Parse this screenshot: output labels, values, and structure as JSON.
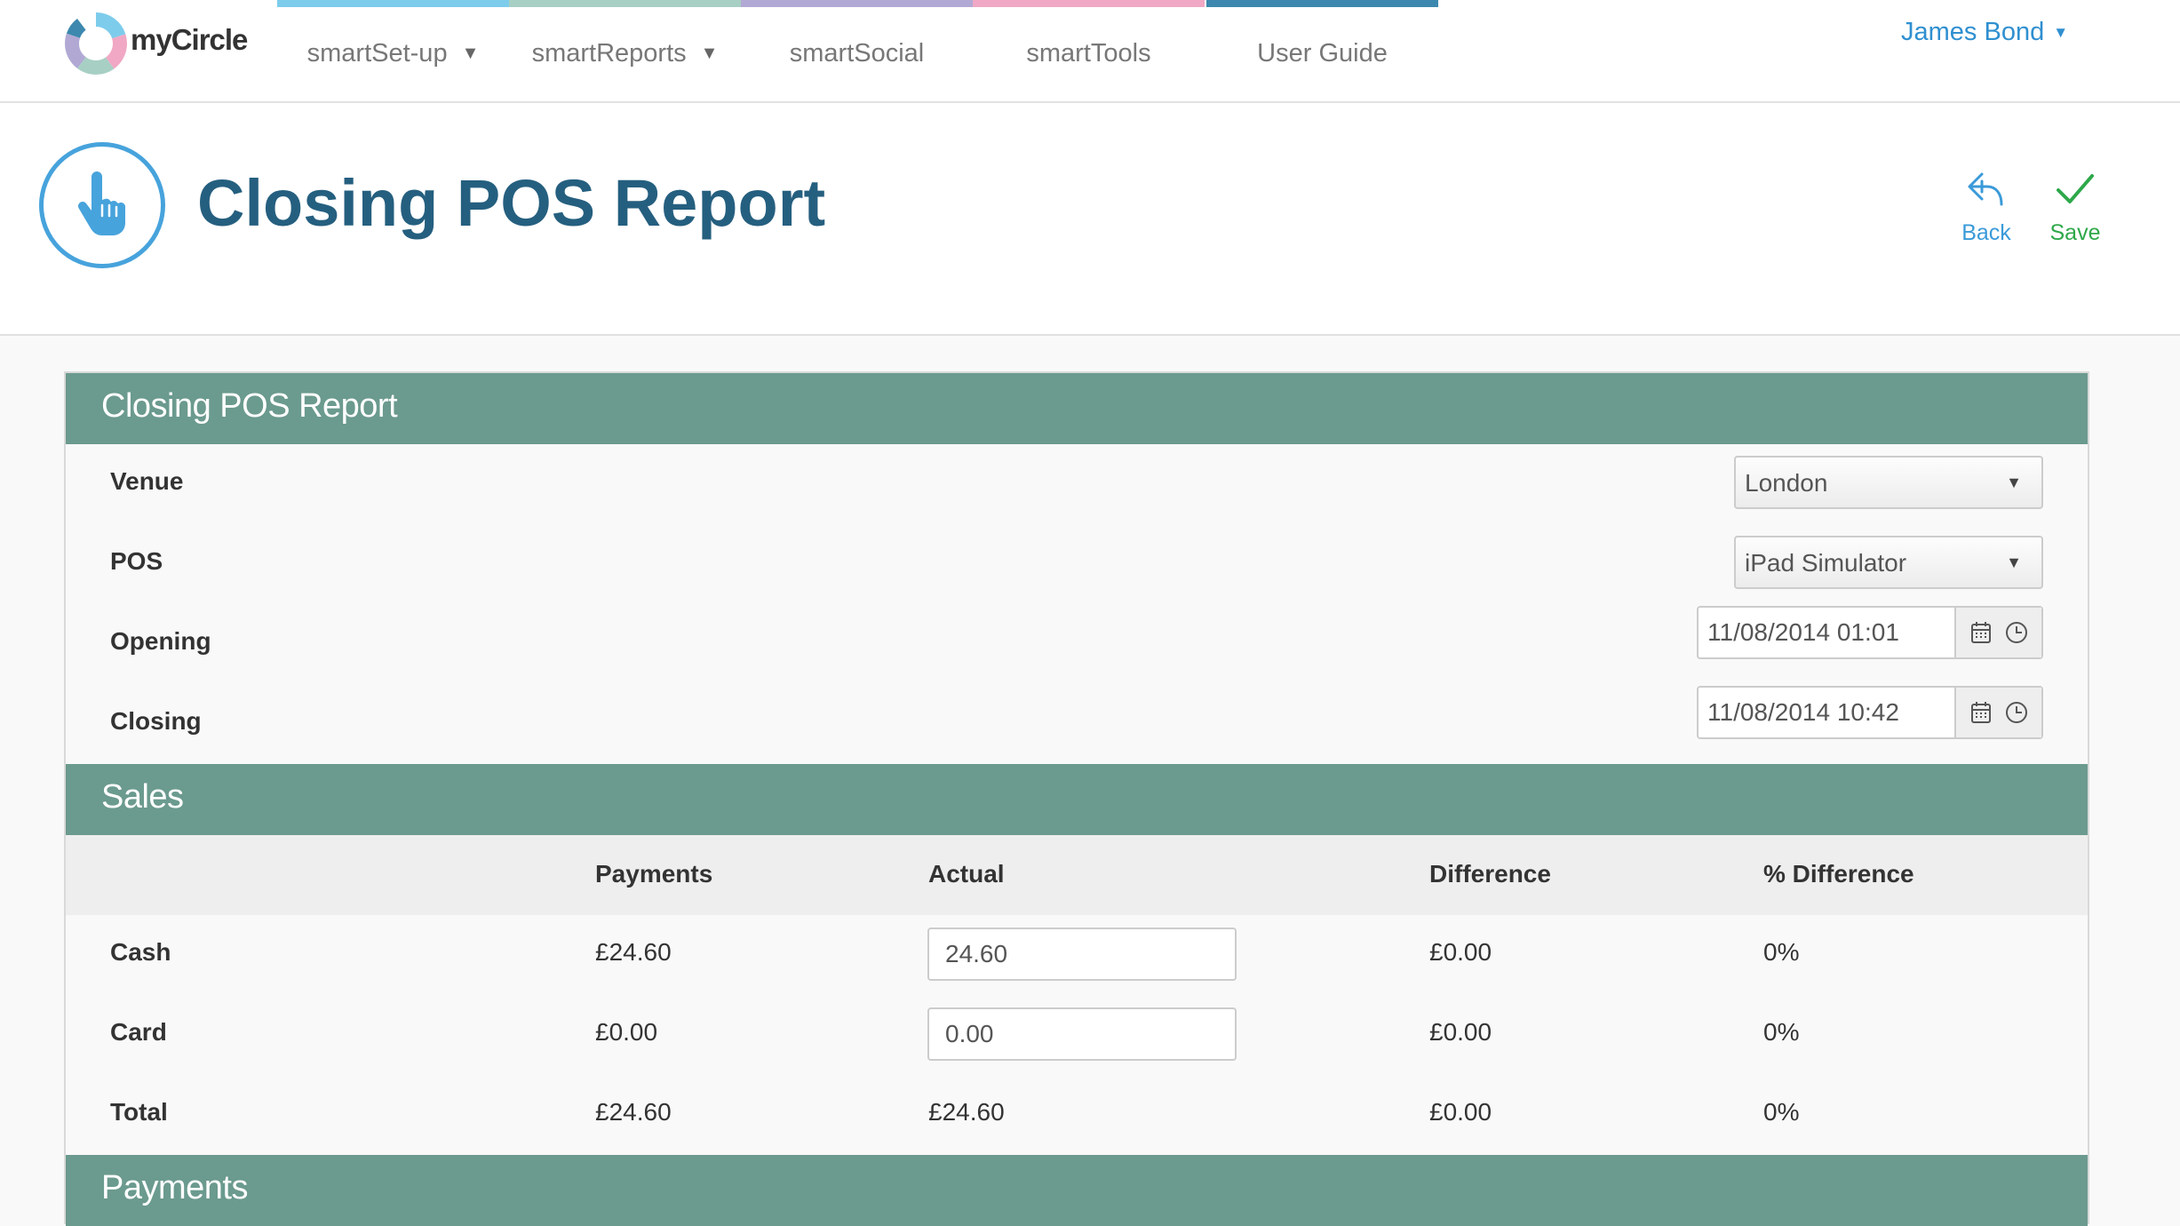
{
  "app": {
    "brand": "myCircle"
  },
  "nav": {
    "items": [
      {
        "label": "smartSet-up",
        "has_dropdown": true,
        "color": "#7dccec"
      },
      {
        "label": "smartReports",
        "has_dropdown": true,
        "color": "#a7cfc4"
      },
      {
        "label": "smartSocial",
        "has_dropdown": false,
        "color": "#b1a9d4"
      },
      {
        "label": "smartTools",
        "has_dropdown": false,
        "color": "#f0a8c4"
      },
      {
        "label": "User Guide",
        "has_dropdown": false,
        "color": "#3c88ae"
      }
    ],
    "user": "James Bond"
  },
  "header": {
    "title": "Closing POS Report",
    "icon": "pointer-hand-icon",
    "back_label": "Back",
    "save_label": "Save"
  },
  "report": {
    "section_title": "Closing POS Report",
    "venue_label": "Venue",
    "venue_value": "London",
    "pos_label": "POS",
    "pos_value": "iPad Simulator",
    "opening_label": "Opening",
    "opening_value": "11/08/2014 01:01",
    "closing_label": "Closing",
    "closing_value": "11/08/2014 10:42"
  },
  "sales": {
    "section_title": "Sales",
    "columns": [
      "Payments",
      "Actual",
      "Difference",
      "% Difference"
    ],
    "rows": [
      {
        "label": "Cash",
        "payments": "£24.60",
        "actual": "24.60",
        "difference": "£0.00",
        "pct": "0%"
      },
      {
        "label": "Card",
        "payments": "£0.00",
        "actual": "0.00",
        "difference": "£0.00",
        "pct": "0%"
      },
      {
        "label": "Total",
        "payments": "£24.60",
        "actual": "£24.60",
        "difference": "£0.00",
        "pct": "0%"
      }
    ]
  },
  "payments": {
    "section_title": "Payments"
  },
  "colors": {
    "section_header": "#6b9a8e",
    "title": "#255f7f",
    "link": "#2f8fd0",
    "save": "#2ea84a"
  }
}
